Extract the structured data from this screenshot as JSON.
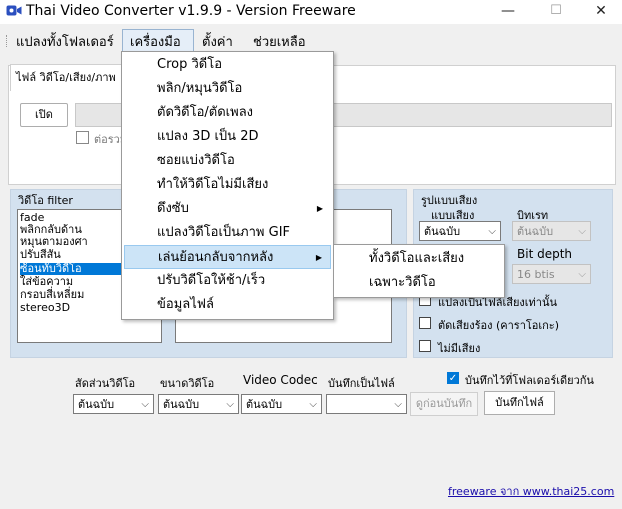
{
  "window": {
    "title": "Thai Video Converter v1.9.9 - Version Freeware",
    "controls": {
      "minimize": "—",
      "maximize": "☐",
      "close": "✕"
    }
  },
  "menubar": {
    "items": [
      "แปลงทั้งโฟลเดอร์",
      "เครื่องมือ",
      "ตั้งค่า",
      "ช่วยเหลือ"
    ]
  },
  "tabs": {
    "active_label": "ไฟล์ วิดีโอ/เสียง/ภาพ"
  },
  "file_input": {
    "open_label": "เปิด",
    "path_value": "",
    "merge_label": "ต่อรวม"
  },
  "video_filter": {
    "title": "วิดีโอ filter",
    "items": [
      "fade",
      "พลิกกลับด้าน",
      "หมุนตามองศา",
      "ปรับสีสัน",
      "ซ้อนทับวิดีโอ",
      "ใส่ข้อความ",
      "กรอบสี่เหลี่ยม",
      "stereo3D"
    ],
    "selected_index": 4
  },
  "audio_format": {
    "title": "รูปแบบเสียง",
    "mode_label": "แบบเสียง",
    "mode_value": "ต้นฉบับ",
    "bitrate_label": "บิทเรท",
    "bitrate_value": "ต้นฉบับ",
    "bit_depth_label": "Bit depth",
    "bit_depth_value": "16 btis",
    "convert_audio_only_label": "แปลงเป็นไฟล์เสียงเท่านั้น",
    "vocal_remove_label": "ตัดเสียงร้อง (คาราโอเกะ)",
    "no_audio_label": "ไม่มีเสียง"
  },
  "output": {
    "aspect_label": "สัดส่วนวิดีโอ",
    "aspect_value": "ต้นฉบับ",
    "size_label": "ขนาดวิดีโอ",
    "size_value": "ต้นฉบับ",
    "codec_label": "Video Codec",
    "codec_value": "ต้นฉบับ",
    "save_as_label": "บันทึกเป็นไฟล์",
    "save_as_value": "",
    "same_folder_label": "บันทึกไว้ที่โฟลเดอร์เดียวกัน",
    "same_folder_checked": true,
    "preview_button": "ดูก่อนบันทึก",
    "save_button": "บันทึกไฟล์"
  },
  "footer": {
    "link_text": "freeware จาก  www.thai25.com"
  },
  "tools_menu": {
    "items": [
      {
        "label": "Crop วิดีโอ"
      },
      {
        "label": "พลิก/หมุนวิดีโอ"
      },
      {
        "label": "ตัดวิดีโอ/ตัดเพลง"
      },
      {
        "label": "แปลง 3D เป็น 2D"
      },
      {
        "label": "ซอยแบ่งวิดีโอ"
      },
      {
        "label": "ทำให้วิดีโอไม่มีเสียง"
      },
      {
        "label": "ดึงซับ",
        "submenu": "▶"
      },
      {
        "label": "แปลงวิดีโอเป็นภาพ GIF"
      },
      {
        "label": "เล่นย้อนกลับจากหลัง",
        "submenu": "▶"
      },
      {
        "label": "ปรับวิดีโอให้ช้า/เร็ว"
      },
      {
        "label": "ข้อมูลไฟล์"
      }
    ],
    "highlighted_index": 8
  },
  "reverse_submenu": {
    "items": [
      "ทั้งวิดีโอและเสียง",
      "เฉพาะวิดีโอ"
    ]
  },
  "icons": {
    "app": "video-camera-icon",
    "dropdown": "chevron-down-icon",
    "submenu": "triangle-right-icon"
  },
  "colors": {
    "accent": "#0078d7",
    "group_background": "#d3e1ef",
    "menu_highlight": "#cce4f7",
    "link": "#1a0dab"
  }
}
